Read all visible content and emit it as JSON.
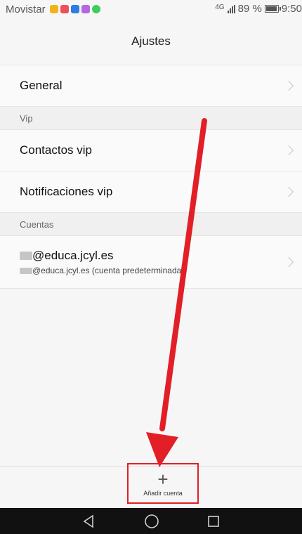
{
  "status_bar": {
    "carrier": "Movistar",
    "signal": "4G",
    "battery": "89 %",
    "time": "9:50"
  },
  "header": {
    "title": "Ajustes"
  },
  "settings": {
    "general_label": "General",
    "vip_section": "Vip",
    "vip_contacts_label": "Contactos vip",
    "vip_notifications_label": "Notificaciones vip",
    "accounts_section": "Cuentas",
    "account_title": "@educa.jcyl.es",
    "account_subtitle": "@educa.jcyl.es (cuenta predeterminada)"
  },
  "bottom": {
    "add_account_label": "Añadir cuenta",
    "add_icon": "+"
  },
  "annotation": {
    "arrow_color": "#e21f26",
    "box_color": "#e21f26"
  }
}
